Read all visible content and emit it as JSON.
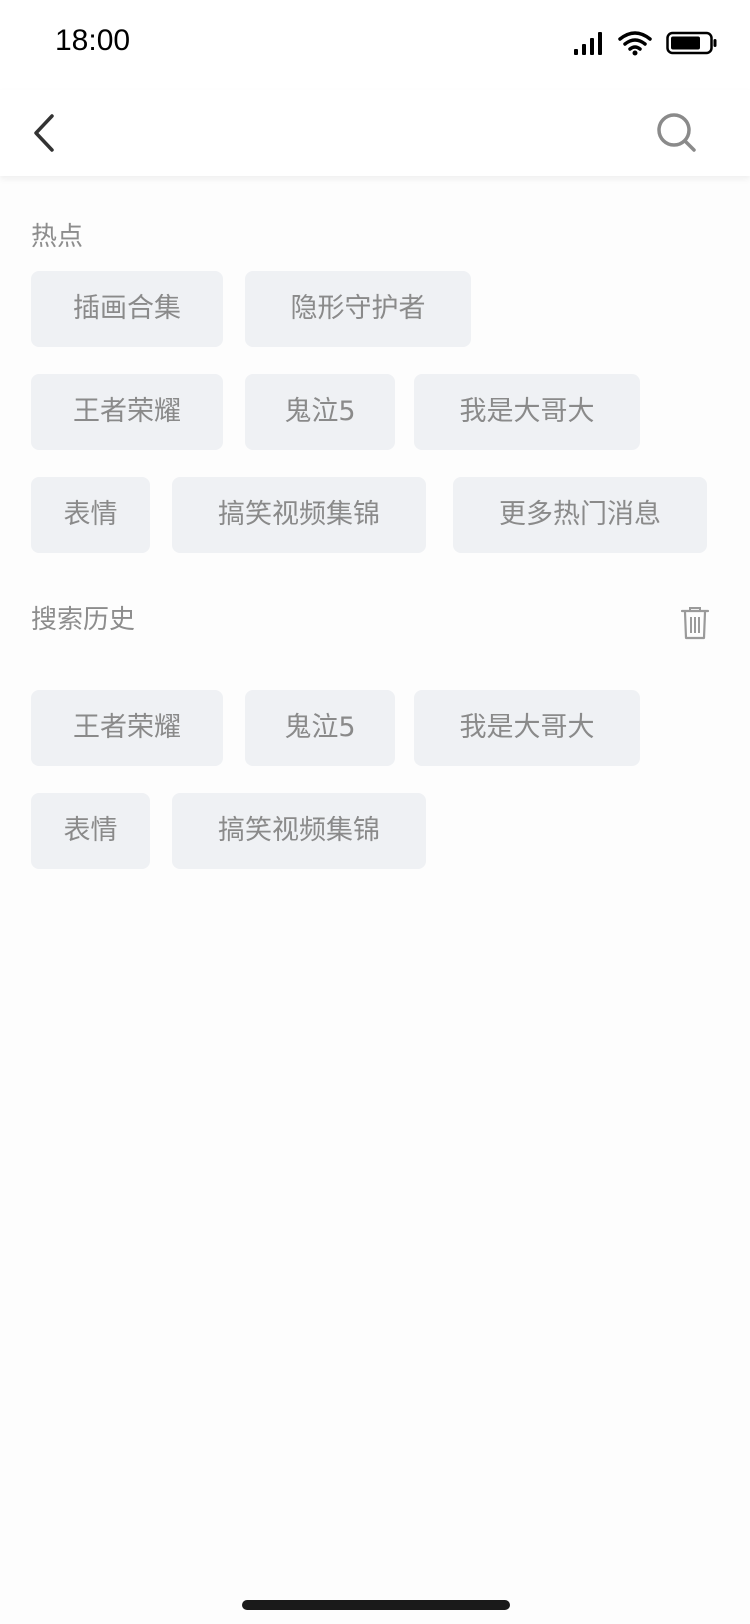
{
  "status_bar": {
    "time": "18:00"
  },
  "nav": {
    "back_icon": "chevron-left-icon",
    "search_icon": "search-icon"
  },
  "hot": {
    "title": "热点",
    "tags": [
      "插画合集",
      "隐形守护者",
      "王者荣耀",
      "鬼泣5",
      "我是大哥大",
      "表情",
      "搞笑视频集锦",
      "更多热门消息"
    ]
  },
  "history": {
    "title": "搜索历史",
    "clear_icon": "trash-icon",
    "tags": [
      "王者荣耀",
      "鬼泣5",
      "我是大哥大",
      "表情",
      "搞笑视频集锦"
    ]
  },
  "colors": {
    "tag_bg": "#eff1f4",
    "tag_text": "#8a8a8a",
    "section_title": "#8d8d8d"
  }
}
